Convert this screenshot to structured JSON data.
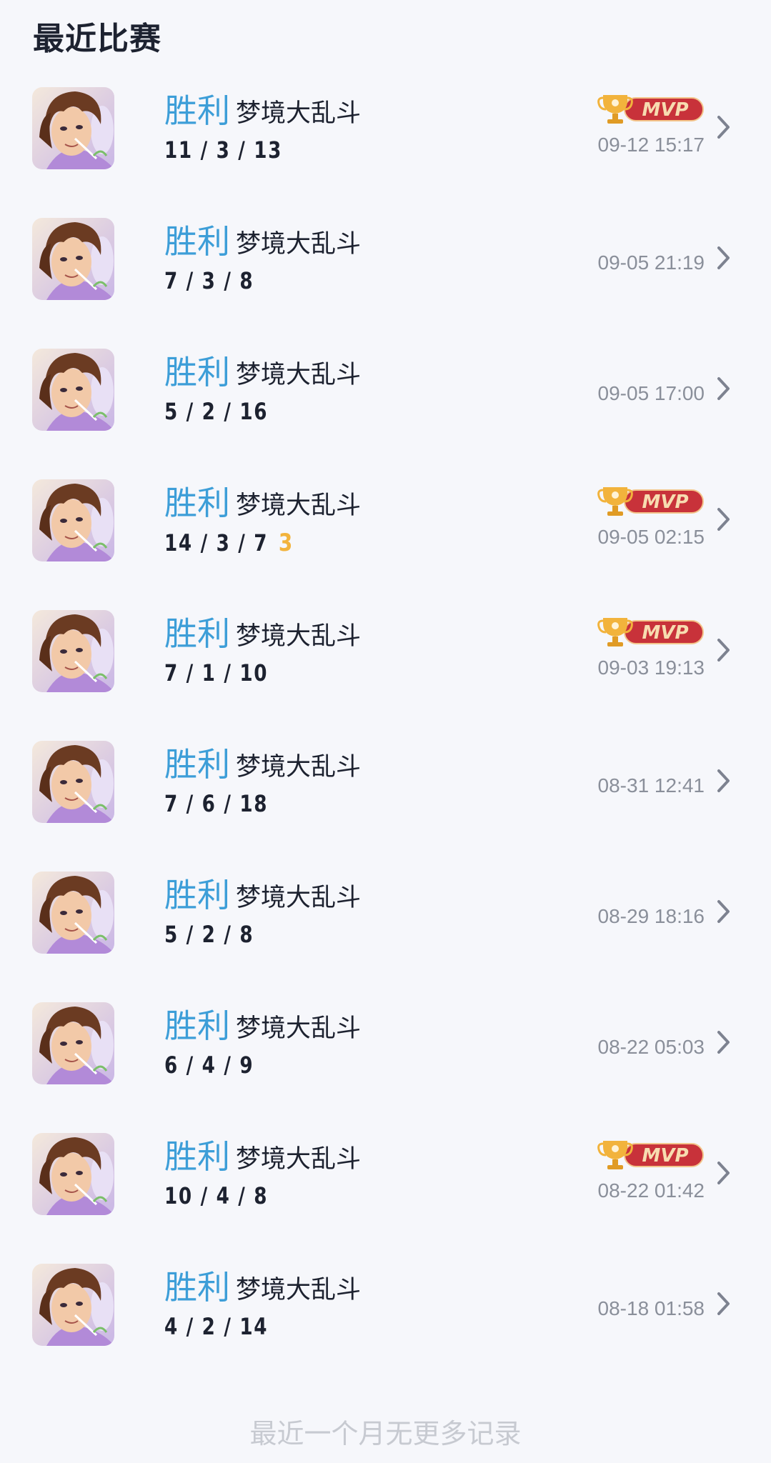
{
  "page": {
    "title": "最近比赛",
    "footer": "最近一个月无更多记录"
  },
  "colors": {
    "result_win": "#3d9ed8",
    "mvp_red": "#c8323a",
    "trophy_gold": "#f2b33c",
    "muted_text": "#8a8f9a",
    "background": "#f6f7fb"
  },
  "icons": {
    "mvp": "mvp-trophy-badge-icon",
    "chevron": "chevron-right-icon",
    "avatar": "hero-avatar"
  },
  "matches": [
    {
      "result": "胜利",
      "mode": "梦境大乱斗",
      "kda": "11 / 3 / 13",
      "multikill": "",
      "mvp": true,
      "time": "09-12 15:17"
    },
    {
      "result": "胜利",
      "mode": "梦境大乱斗",
      "kda": "7 / 3 / 8",
      "multikill": "",
      "mvp": false,
      "time": "09-05 21:19"
    },
    {
      "result": "胜利",
      "mode": "梦境大乱斗",
      "kda": "5 / 2 / 16",
      "multikill": "",
      "mvp": false,
      "time": "09-05 17:00"
    },
    {
      "result": "胜利",
      "mode": "梦境大乱斗",
      "kda": "14 / 3 / 7",
      "multikill": "3",
      "mvp": true,
      "time": "09-05 02:15"
    },
    {
      "result": "胜利",
      "mode": "梦境大乱斗",
      "kda": "7 / 1 / 10",
      "multikill": "",
      "mvp": true,
      "time": "09-03 19:13"
    },
    {
      "result": "胜利",
      "mode": "梦境大乱斗",
      "kda": "7 / 6 / 18",
      "multikill": "",
      "mvp": false,
      "time": "08-31 12:41"
    },
    {
      "result": "胜利",
      "mode": "梦境大乱斗",
      "kda": "5 / 2 / 8",
      "multikill": "",
      "mvp": false,
      "time": "08-29 18:16"
    },
    {
      "result": "胜利",
      "mode": "梦境大乱斗",
      "kda": "6 / 4 / 9",
      "multikill": "",
      "mvp": false,
      "time": "08-22 05:03"
    },
    {
      "result": "胜利",
      "mode": "梦境大乱斗",
      "kda": "10 / 4 / 8",
      "multikill": "",
      "mvp": true,
      "time": "08-22 01:42"
    },
    {
      "result": "胜利",
      "mode": "梦境大乱斗",
      "kda": "4 / 2 / 14",
      "multikill": "",
      "mvp": false,
      "time": "08-18 01:58"
    }
  ]
}
